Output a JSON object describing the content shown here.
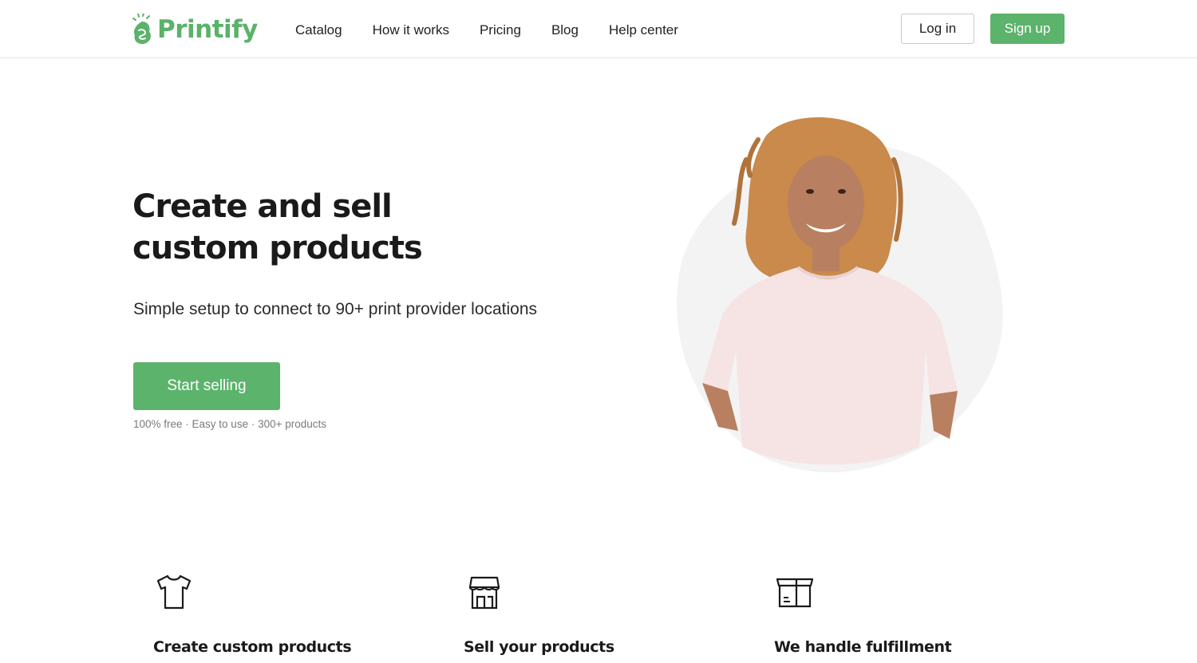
{
  "brand": {
    "name": "Printify",
    "color": "#5bb26a",
    "icon": "printify-logo-icon"
  },
  "nav": {
    "items": [
      {
        "label": "Catalog"
      },
      {
        "label": "How it works"
      },
      {
        "label": "Pricing"
      },
      {
        "label": "Blog"
      },
      {
        "label": "Help center"
      }
    ],
    "login_label": "Log in",
    "signup_label": "Sign up"
  },
  "hero": {
    "title_line1": "Create and sell",
    "title_line2": "custom products",
    "subtitle": "Simple setup to connect to 90+ print provider locations",
    "cta_label": "Start selling",
    "meta": "100% free · Easy to use  · 300+ products",
    "image": "woman-in-pink-tshirt"
  },
  "features": [
    {
      "icon": "tshirt-icon",
      "title": "Create custom products"
    },
    {
      "icon": "storefront-icon",
      "title": "Sell your products"
    },
    {
      "icon": "box-icon",
      "title": "We handle fulfillment"
    }
  ],
  "colors": {
    "accent": "#5cb36b",
    "text": "#1a1a1a",
    "muted": "#7a7a7a"
  }
}
